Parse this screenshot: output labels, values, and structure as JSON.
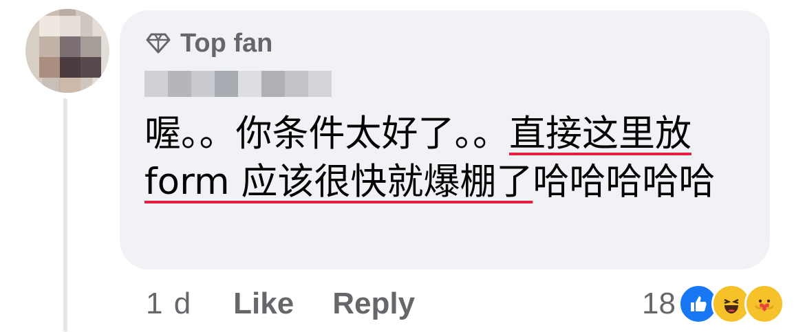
{
  "comment": {
    "badge_label": "Top fan",
    "badge_icon": "diamond-icon",
    "author_name": "",
    "text_plain_1": "喔。。你条件太好了。。",
    "text_underlined": "直接这里放 form 应该很快就爆棚了",
    "text_plain_2": "哈哈哈哈哈",
    "underline_color": "#e41e3f"
  },
  "actions": {
    "time": "1 d",
    "like_label": "Like",
    "reply_label": "Reply"
  },
  "reactions": {
    "count": "18",
    "icons": [
      "like-reaction-icon",
      "haha-reaction-icon",
      "care-reaction-icon"
    ]
  },
  "colors": {
    "bubble": "#f0f2f5",
    "secondary_text": "#65676b",
    "text": "#050505",
    "like_blue": "#1877f2"
  }
}
